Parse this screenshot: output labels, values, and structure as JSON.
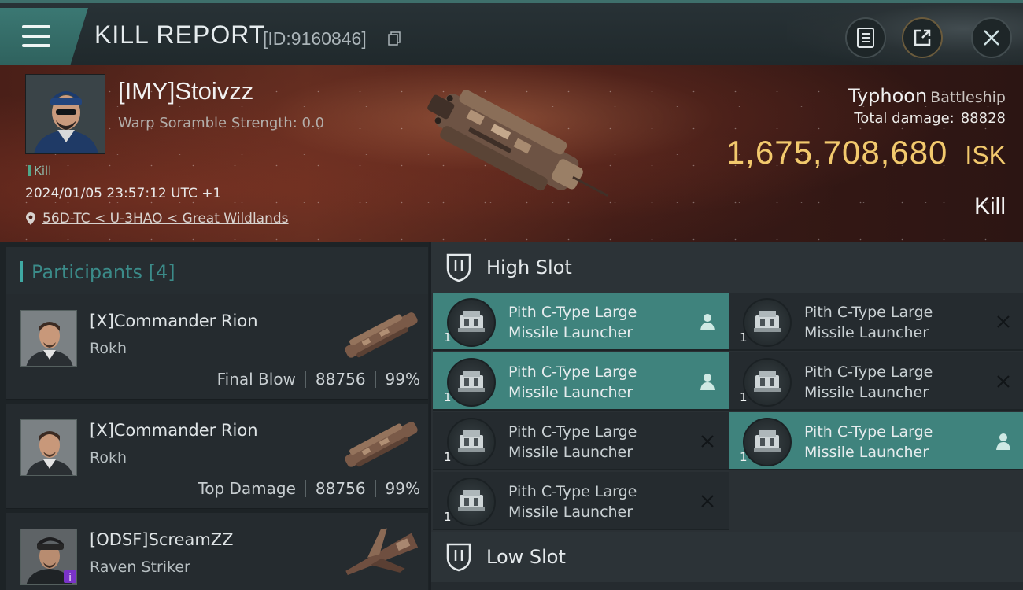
{
  "header": {
    "title": "KILL REPORT",
    "report_id": "[ID:9160846]"
  },
  "victim": {
    "name": "[IMY]Stoivzz",
    "scramble": "Warp Soramble Strength: 0.0",
    "tag": "Kill",
    "timestamp": "2024/01/05 23:57:12 UTC +1",
    "location": "56D-TC < U-3HAO < Great Wildlands",
    "ship_name": "Typhoon",
    "ship_class": "Battleship",
    "total_damage_label": "Total damage:",
    "total_damage": "88828",
    "isk_value": "1,675,708,680",
    "isk_unit": "ISK",
    "result": "Kill"
  },
  "participants": {
    "title": "Participants [4]",
    "list": [
      {
        "name": "[X]Commander Rion",
        "ship": "Rokh",
        "role": "Final Blow",
        "damage": "88756",
        "percent": "99%"
      },
      {
        "name": "[X]Commander Rion",
        "ship": "Rokh",
        "role": "Top Damage",
        "damage": "88756",
        "percent": "99%"
      },
      {
        "name": "[ODSF]ScreamZZ",
        "ship": "Raven Striker"
      }
    ]
  },
  "fitting": {
    "high_slot_title": "High Slot",
    "low_slot_title": "Low Slot",
    "modules": [
      {
        "line1": "Pith C-Type Large",
        "line2": "Missile Launcher",
        "qty": "1",
        "state": "active"
      },
      {
        "line1": "Pith C-Type Large",
        "line2": "Missile Launcher",
        "qty": "1",
        "state": "dropped"
      },
      {
        "line1": "Pith C-Type Large",
        "line2": "Missile Launcher",
        "qty": "1",
        "state": "active"
      },
      {
        "line1": "Pith C-Type Large",
        "line2": "Missile Launcher",
        "qty": "1",
        "state": "dropped"
      },
      {
        "line1": "Pith C-Type Large",
        "line2": "Missile Launcher",
        "qty": "1",
        "state": "dropped"
      },
      {
        "line1": "Pith C-Type Large",
        "line2": "Missile Launcher",
        "qty": "1",
        "state": "active"
      },
      {
        "line1": "Pith C-Type Large",
        "line2": "Missile Launcher",
        "qty": "1",
        "state": "dropped"
      }
    ]
  },
  "colors": {
    "accent_teal": "#3f837d",
    "isk_gold": "#f2c96d",
    "participants_accent": "#3fa9a3"
  },
  "icons": {
    "menu": "hamburger-icon",
    "copy": "copy-icon",
    "notes": "notes-icon",
    "share": "share-icon",
    "close": "close-icon",
    "location": "location-pin-icon",
    "slot": "shield-icon",
    "owner": "person-icon",
    "dropped": "x-icon"
  }
}
